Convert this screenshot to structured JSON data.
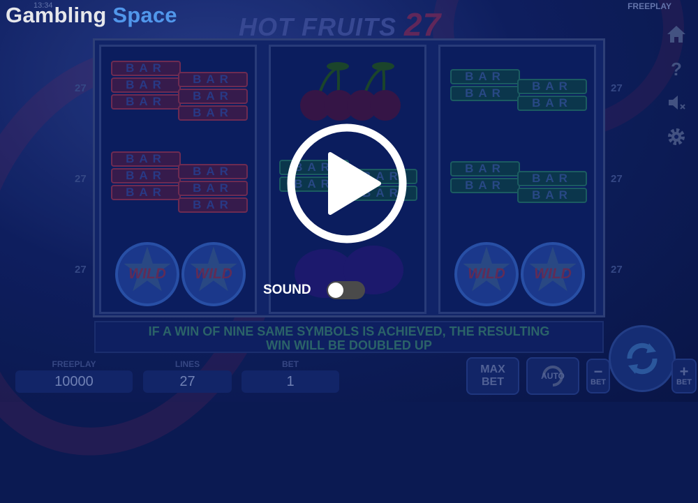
{
  "status": {
    "time": "13:34",
    "mode": "FREEPLAY"
  },
  "brand": {
    "part1": "Gambling ",
    "part2": "Space"
  },
  "game": {
    "title": "HOT FRUITS",
    "title_number": "27"
  },
  "line_marker": "27",
  "symbols": {
    "bar": "BAR",
    "wild": "WILD"
  },
  "sound": {
    "label": "SOUND",
    "enabled": false
  },
  "info_text": {
    "line1": "IF A WIN OF NINE SAME SYMBOLS IS ACHIEVED, THE RESULTING",
    "line2": "WIN WILL BE DOUBLED UP"
  },
  "stats": {
    "credit": {
      "label": "FREEPLAY",
      "value": "10000"
    },
    "lines": {
      "label": "LINES",
      "value": "27"
    },
    "bet": {
      "label": "BET",
      "value": "1"
    }
  },
  "controls": {
    "max_bet_top": "MAX",
    "max_bet_bottom": "BET",
    "auto": "AUTO",
    "bet_minus": "BET",
    "bet_plus": "BET"
  },
  "icons": [
    "home-icon",
    "help-icon",
    "sound-mute-icon",
    "settings-gear-icon",
    "play-icon",
    "spin-icon",
    "auto-icon"
  ],
  "colors": {
    "brand_accent": "#5aa6ff",
    "background": "#0b1a52"
  }
}
